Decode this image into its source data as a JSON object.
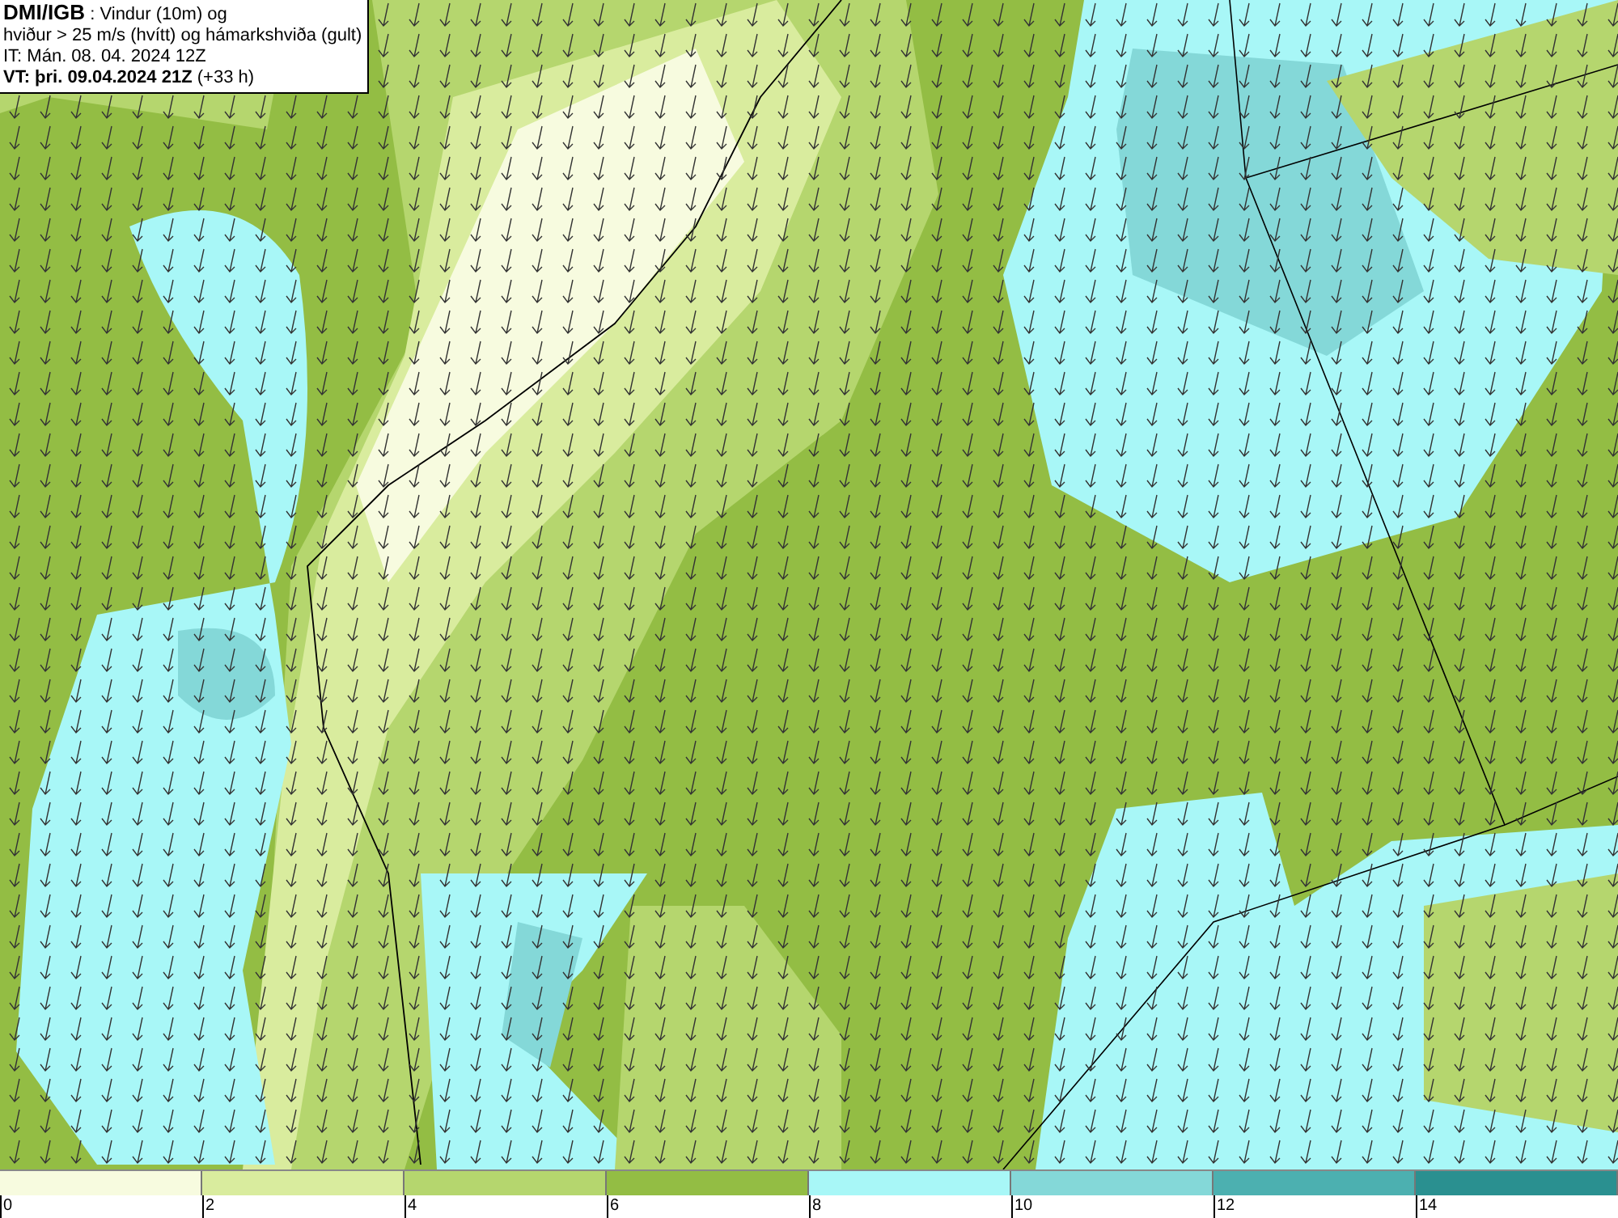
{
  "title_box": {
    "source": "DMI/IGB",
    "subtitle": ": Vindur (10m) og",
    "line_2": "hviður > 25 m/s (hvítt) og hámarkshviða (gult)",
    "line_3": "IT: Mán. 08. 04. 2024 12Z",
    "valid_time": "VT: þri. 09.04.2024 21Z",
    "lead_time": "(+33 h)"
  },
  "legend": [
    {
      "label": "0",
      "color": "#f7fbdf"
    },
    {
      "label": "2",
      "color": "#d9ec9e"
    },
    {
      "label": "4",
      "color": "#b5d66e"
    },
    {
      "label": "6",
      "color": "#93bd44"
    },
    {
      "label": "8",
      "color": "#a8f7f7"
    },
    {
      "label": "10",
      "color": "#84d8d8"
    },
    {
      "label": "12",
      "color": "#4cb0b0"
    },
    {
      "label": "14",
      "color": "#2a9090"
    }
  ]
}
